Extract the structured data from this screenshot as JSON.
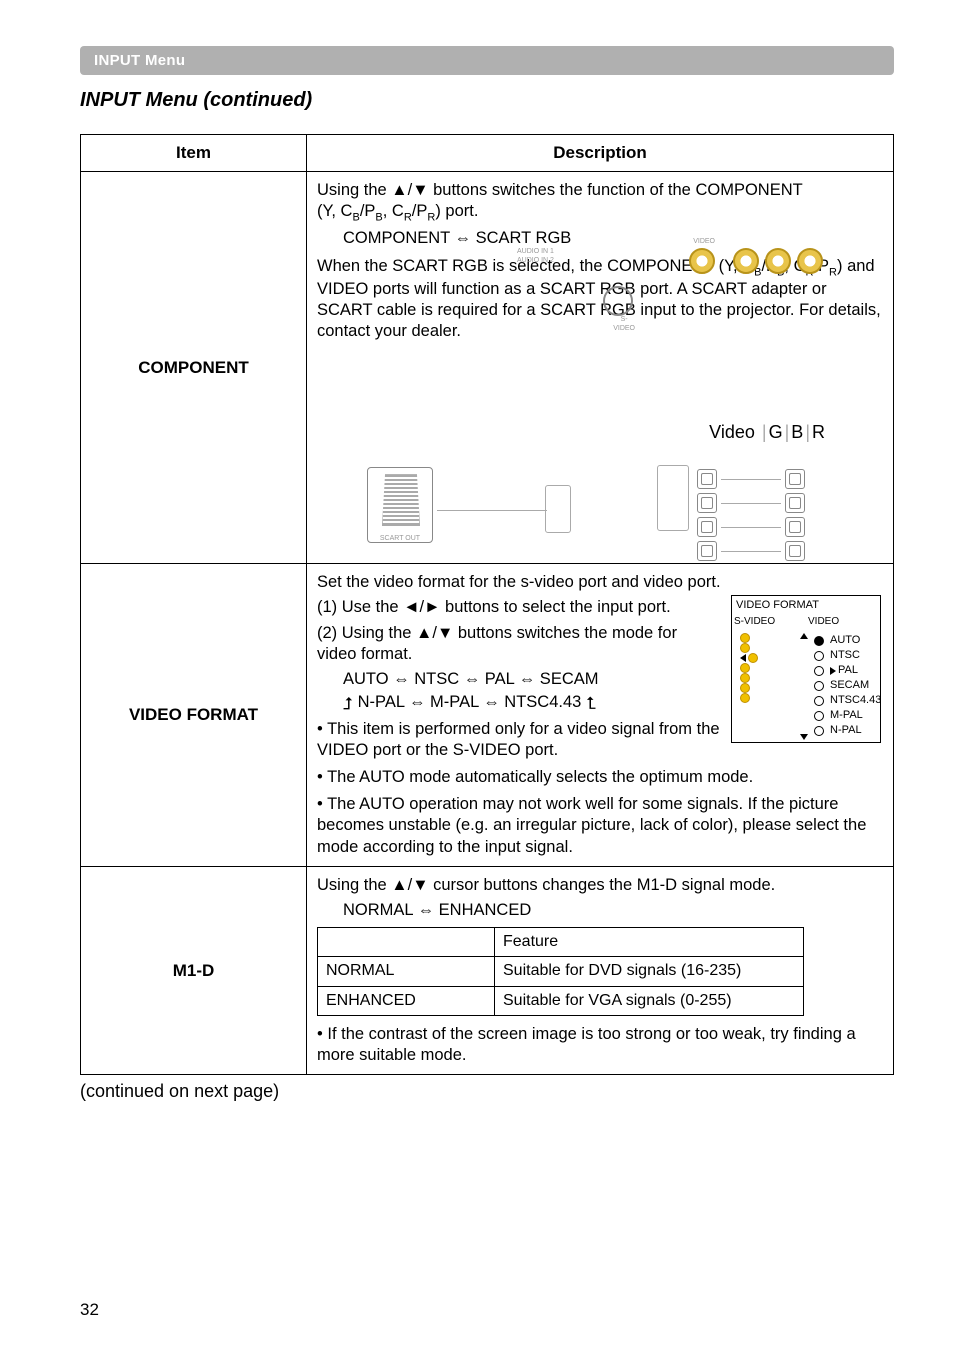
{
  "section_band": "INPUT Menu",
  "cont_title": "INPUT Menu (continued)",
  "table": {
    "head_item": "Item",
    "head_desc": "Description"
  },
  "component": {
    "item": "COMPONENT",
    "p1a": "Using the ▲/▼ buttons switches the function of the COMPONENT",
    "p1b": "(Y, C",
    "p1b_s1": "B",
    "p1b_mid1": "/P",
    "p1b_s2": "B",
    "p1b_mid2": ", C",
    "p1b_s3": "R",
    "p1b_mid3": "/P",
    "p1b_s4": "R",
    "p1b_end": ") port.",
    "p2": "COMPONENT ⇔ SCART RGB",
    "p3a": "When the SCART RGB is selected, the COMPONENT (Y, C",
    "p3a_s1": "B",
    "p3a_m1": "/P",
    "p3a_s2": "B",
    "p3a_m2": ",",
    "p3b": "C",
    "p3b_s1": "R",
    "p3b_m1": "/P",
    "p3b_s2": "R",
    "p3b_end": ") and VIDEO ports will function as a SCART RGB port. A SCART adapter or SCART cable is required for a SCART RGB input to the projector. For details, contact your dealer.",
    "video_gbr_v": "Video",
    "video_gbr_g": "G",
    "video_gbr_b": "B",
    "video_gbr_r": "R",
    "scart_label": "SCART OUT",
    "audio1": "AUDIO IN 1",
    "audio2": "AUDIO IN 2",
    "svideo_lbl": "S-VIDEO",
    "video_lbl": "VIDEO"
  },
  "videoformat": {
    "item": "VIDEO FORMAT",
    "l1": "Set the video format for the s-video port and video port.",
    "l2": "(1) Use the ◄/► buttons to select the input port.",
    "l3": "(2) Using the ▲/▼ buttons switches the mode for video format.",
    "opt1": "AUTO  ⇔  NTSC  ⇔  PAL  ⇔  SECAM",
    "opt2": "N-PAL ⇔ M-PAL ⇔ NTSC4.43",
    "b1": "• This item is performed only for a video signal from the VIDEO port or the S-VIDEO port.",
    "b2": "• The AUTO mode automatically selects the optimum mode.",
    "b3": "• The AUTO operation may not work well for some signals. If the picture becomes unstable (e.g. an irregular picture, lack of color), please select the mode according to the input signal.",
    "box": {
      "title": "VIDEO FORMAT",
      "c1": "S-VIDEO",
      "c2": "VIDEO",
      "rows": [
        "AUTO",
        "NTSC",
        "PAL",
        "SECAM",
        "NTSC4.43",
        "M-PAL",
        "N-PAL"
      ]
    }
  },
  "m1d": {
    "item": "M1-D",
    "l1": "Using the ▲/▼ cursor buttons changes the M1-D signal mode.",
    "l2": "NORMAL ⇔ ENHANCED",
    "tbl": {
      "h": "Feature",
      "r1a": "NORMAL",
      "r1b": "Suitable for DVD signals (16-235)",
      "r2a": "ENHANCED",
      "r2b": "Suitable for VGA signals (0-255)"
    },
    "note": "• If the contrast of the screen image is too strong or too weak, try finding a more suitable mode."
  },
  "cont_note": "(continued on next page)",
  "page_num": "32"
}
